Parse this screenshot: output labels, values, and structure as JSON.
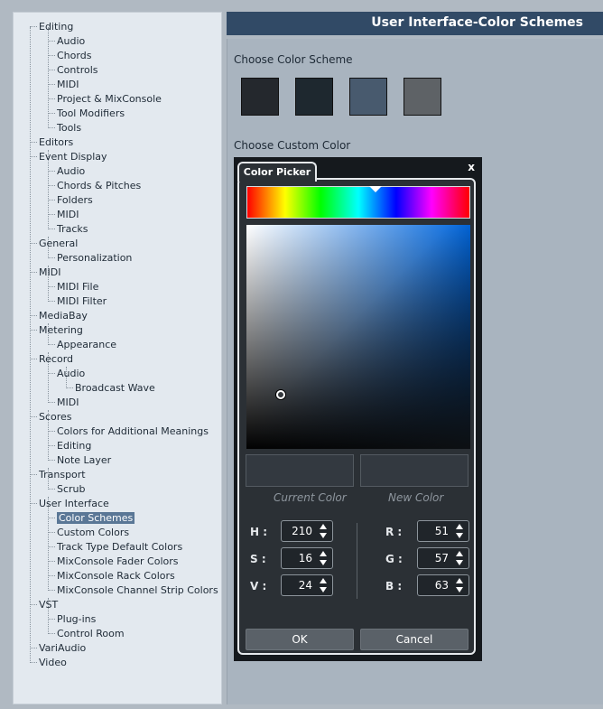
{
  "header": {
    "title": "User Interface-Color Schemes"
  },
  "tree": [
    {
      "label": "Editing"
    },
    {
      "label": "Audio"
    },
    {
      "label": "Chords"
    },
    {
      "label": "Controls"
    },
    {
      "label": "MIDI"
    },
    {
      "label": "Project & MixConsole"
    },
    {
      "label": "Tool Modifiers"
    },
    {
      "label": "Tools"
    },
    {
      "label": "Editors"
    },
    {
      "label": "Event Display"
    },
    {
      "label": "Audio"
    },
    {
      "label": "Chords & Pitches"
    },
    {
      "label": "Folders"
    },
    {
      "label": "MIDI"
    },
    {
      "label": "Tracks"
    },
    {
      "label": "General"
    },
    {
      "label": "Personalization"
    },
    {
      "label": "MIDI"
    },
    {
      "label": "MIDI File"
    },
    {
      "label": "MIDI Filter"
    },
    {
      "label": "MediaBay"
    },
    {
      "label": "Metering"
    },
    {
      "label": "Appearance"
    },
    {
      "label": "Record"
    },
    {
      "label": "Audio"
    },
    {
      "label": "Broadcast Wave"
    },
    {
      "label": "MIDI"
    },
    {
      "label": "Scores"
    },
    {
      "label": "Colors for Additional Meanings"
    },
    {
      "label": "Editing"
    },
    {
      "label": "Note Layer"
    },
    {
      "label": "Transport"
    },
    {
      "label": "Scrub"
    },
    {
      "label": "User Interface"
    },
    {
      "label": "Color Schemes"
    },
    {
      "label": "Custom Colors"
    },
    {
      "label": "Track Type Default Colors"
    },
    {
      "label": "MixConsole Fader Colors"
    },
    {
      "label": "MixConsole Rack Colors"
    },
    {
      "label": "MixConsole Channel Strip Colors"
    },
    {
      "label": "VST"
    },
    {
      "label": "Plug-ins"
    },
    {
      "label": "Control Room"
    },
    {
      "label": "VariAudio"
    },
    {
      "label": "Video"
    }
  ],
  "selected_tree_item": "Color Schemes",
  "scheme": {
    "label": "Choose Color Scheme",
    "swatches": [
      "#24282d",
      "#1e282f",
      "#485a6e",
      "#5e6266"
    ]
  },
  "custom": {
    "label": "Choose Custom Color"
  },
  "picker": {
    "tab_label": "Color Picker",
    "close_label": "x",
    "current_label": "Current Color",
    "new_label": "New Color",
    "h_label": "H :",
    "s_label": "S :",
    "v_label": "V :",
    "r_label": "R :",
    "g_label": "G :",
    "b_label": "B :",
    "h": "210",
    "s": "16",
    "v": "24",
    "r": "51",
    "g": "57",
    "b": "63",
    "ok_label": "OK",
    "cancel_label": "Cancel"
  },
  "colors": {
    "header_bg": "#314a66",
    "selected_bg": "#5a7796",
    "current_color": "#333940"
  }
}
